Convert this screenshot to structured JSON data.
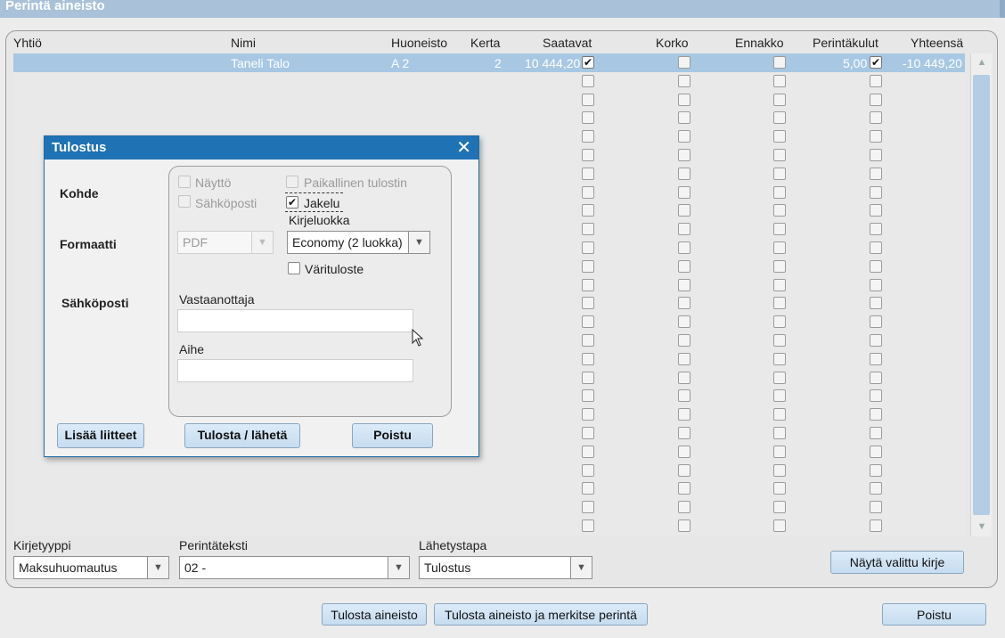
{
  "window": {
    "title": "Perintä aineisto"
  },
  "table": {
    "headers": [
      "Yhtiö",
      "Nimi",
      "Huoneisto",
      "Kerta",
      "Saatavat",
      "Korko",
      "Ennakko",
      "Perintäkulut",
      "Yhteensä"
    ],
    "rows": [
      {
        "yhtio": "",
        "nimi": "Taneli Talo",
        "huoneisto": "A 2",
        "kerta": "2",
        "saatavat": "10 444,20",
        "saatavat_checked": true,
        "korko_checked": false,
        "ennakko_checked": false,
        "perintakulut": "5,00",
        "perintakulut_checked": true,
        "yhteensa": "-10 449,20"
      }
    ],
    "selected_row_color": "#a7c7e3"
  },
  "bottom": {
    "kirjetyyppi_label": "Kirjetyyppi",
    "kirjetyyppi_value": "Maksuhuomautus",
    "perintateksti_label": "Perintäteksti",
    "perintateksti_value": "02 -",
    "lahetystapa_label": "Lähetystapa",
    "lahetystapa_value": "Tulostus",
    "show_letter_button": "Näytä valittu kirje",
    "print_material_button": "Tulosta aineisto",
    "print_and_mark_button": "Tulosta aineisto ja merkitse perintä",
    "exit_button": "Poistu"
  },
  "dialog": {
    "title": "Tulostus",
    "kohde_label": "Kohde",
    "formaatti_label": "Formaatti",
    "sahkoposti_label": "Sähköposti",
    "naytto": "Näyttö",
    "sahkoposti_option": "Sähköposti",
    "paikallinen": "Paikallinen tulostin",
    "jakelu": "Jakelu",
    "jakelu_checked": true,
    "kirjeluokka_label": "Kirjeluokka",
    "format_value": "PDF",
    "kirjeluokka_value": "Economy (2 luokka)",
    "varituloste": "Värituloste",
    "vastaanottaja_label": "Vastaanottaja",
    "vastaanottaja_value": "",
    "aihe_label": "Aihe",
    "aihe_value": "",
    "add_attachments_button": "Lisää liitteet",
    "print_send_button": "Tulosta / lähetä",
    "exit_button": "Poistu",
    "header_color": "#1f73b4"
  },
  "icons": {
    "dropdown": "chevron-down-icon",
    "close": "close-icon",
    "check": "check-icon",
    "cursor": "mouse-pointer-icon"
  }
}
